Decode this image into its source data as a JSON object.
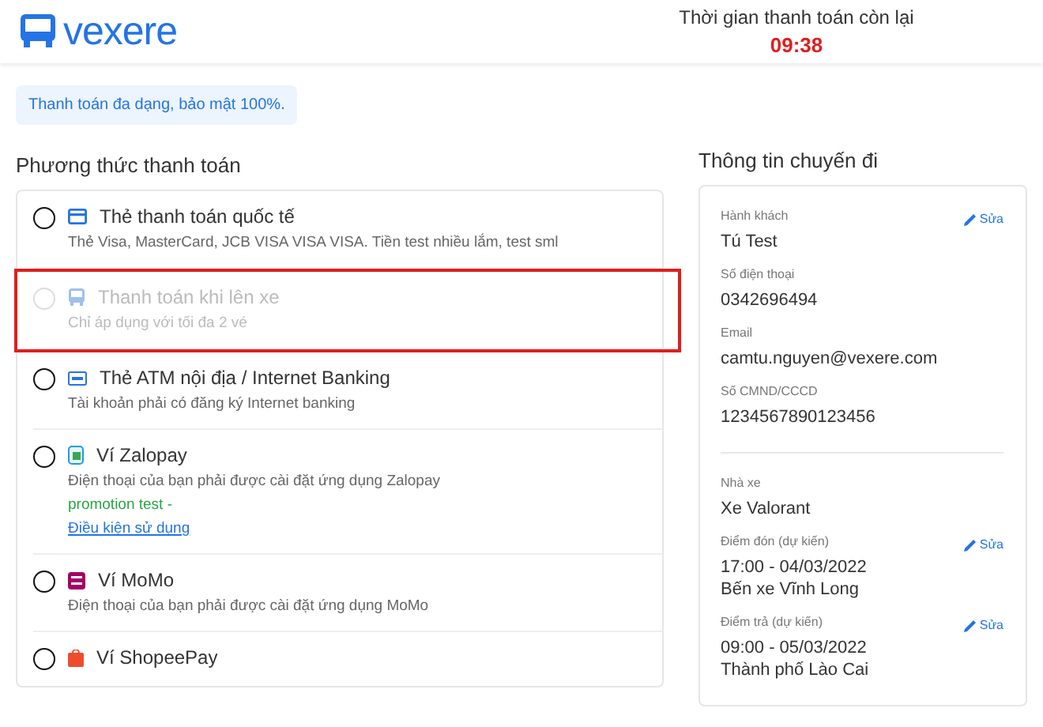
{
  "header": {
    "logo": "vexere",
    "timer_label": "Thời gian thanh toán còn lại",
    "timer": "09:38"
  },
  "notice": "Thanh toán đa dạng, bảo mật 100%.",
  "payment": {
    "title": "Phương thức thanh toán",
    "methods": [
      {
        "kind": "card",
        "title": "Thẻ thanh toán quốc tế",
        "description": "Thẻ Visa, MasterCard, JCB VISA VISA VISA. Tiền test nhiều lắm, test sml",
        "selected": false,
        "disabled": false
      },
      {
        "kind": "bus",
        "title": "Thanh toán khi lên xe",
        "description": "Chỉ áp dụng với tối đa 2 vé",
        "selected": false,
        "disabled": true,
        "highlighted": true
      },
      {
        "kind": "atm",
        "title": "Thẻ ATM nội địa / Internet Banking",
        "description": "Tài khoản phải có đăng ký Internet banking",
        "selected": false,
        "disabled": false
      },
      {
        "kind": "zalopay",
        "title": "Ví Zalopay",
        "description": "Điện thoại của bạn phải được cài đặt ứng dụng Zalopay",
        "promotion": "promotion test -",
        "link": "Điều kiện sử dụng",
        "selected": false,
        "disabled": false
      },
      {
        "kind": "momo",
        "title": "Ví MoMo",
        "description": "Điện thoại của bạn phải được cài đặt ứng dụng MoMo",
        "selected": false,
        "disabled": false
      },
      {
        "kind": "shopeepay",
        "title": "Ví ShopeePay",
        "selected": false,
        "disabled": false
      }
    ]
  },
  "trip": {
    "title": "Thông tin chuyến đi",
    "sections": [
      {
        "fields": [
          {
            "label": "Hành khách",
            "values": [
              "Tú Test"
            ],
            "edit": "Sửa"
          },
          {
            "label": "Số điện thoại",
            "values": [
              "0342696494"
            ]
          },
          {
            "label": "Email",
            "values": [
              "camtu.nguyen@vexere.com"
            ]
          },
          {
            "label": "Số CMND/CCCD",
            "values": [
              "1234567890123456"
            ]
          }
        ]
      },
      {
        "fields": [
          {
            "label": "Nhà xe",
            "values": [
              "Xe Valorant"
            ]
          },
          {
            "label": "Điểm đón (dự kiến)",
            "values": [
              "17:00 - 04/03/2022",
              "Bến xe Vĩnh Long"
            ],
            "edit": "Sửa"
          },
          {
            "label": "Điểm trả (dự kiến)",
            "values": [
              "09:00 - 05/03/2022",
              "Thành phố Lào Cai"
            ],
            "edit": "Sửa"
          }
        ]
      }
    ]
  }
}
